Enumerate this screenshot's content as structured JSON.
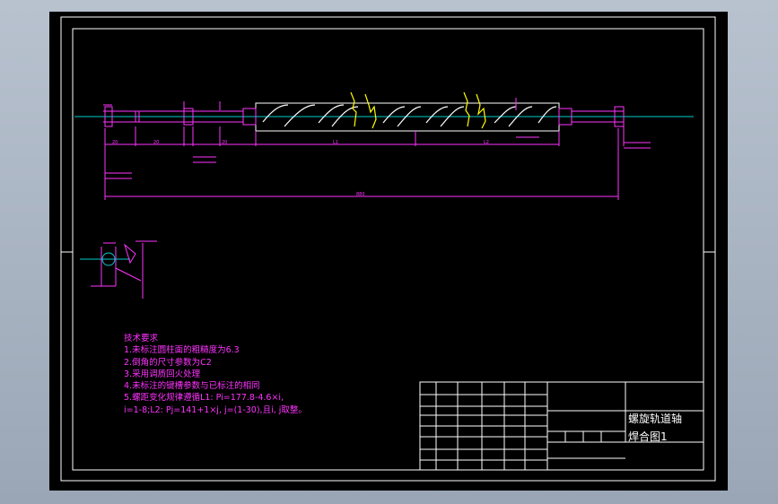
{
  "colors": {
    "background": "#000000",
    "frame": "#ffffff",
    "dimension": "#ff33ff",
    "centerline": "#00cccc",
    "break_lines": "#ffff00"
  },
  "drawing": {
    "title_line1": "螺旋轨道轴",
    "title_line2": "焊合图1",
    "tech_title": "技术要求",
    "tech_items": [
      "1.未标注圆柱面的粗糙度为6.3",
      "2.倒角的尺寸参数为C2",
      "3.采用调质回火处理",
      "4.未标注的键槽参数与已标注的相同",
      "5.螺距变化规律遵循L1:  Pi=177.8-4.6×i,",
      "i=1-8;L2:  Pj=141+1×j, j=(1-30),且i, j取整。"
    ],
    "dimensions": {
      "overall": "880",
      "segment_a": "20",
      "segment_b": "20",
      "segment_c": "20",
      "segment_l1": "L1",
      "segment_l2": "L2"
    }
  }
}
